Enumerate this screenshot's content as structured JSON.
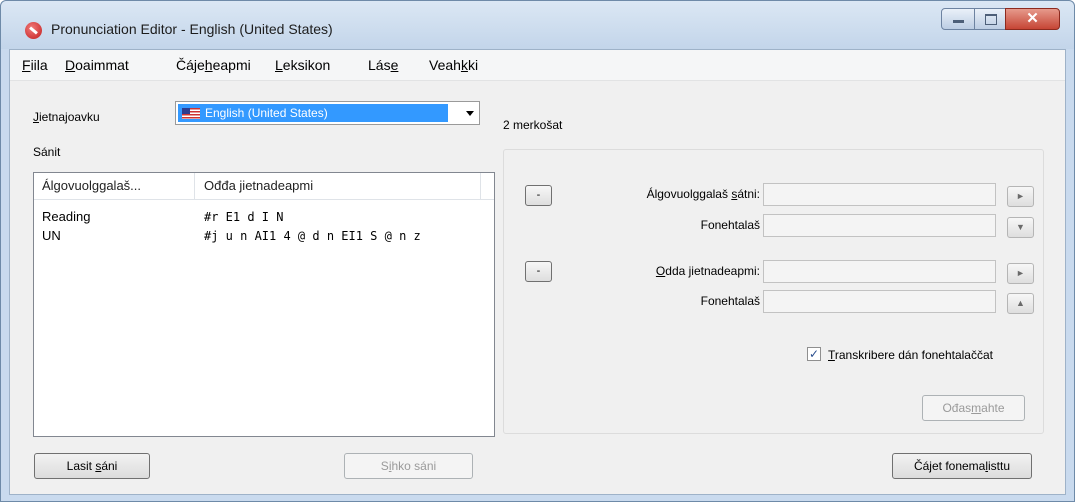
{
  "window": {
    "title": "Pronunciation Editor - English (United States)"
  },
  "menu": [
    {
      "pre": "",
      "ul": "F",
      "post": "iila"
    },
    {
      "pre": "",
      "ul": "D",
      "post": "oaimmat"
    },
    {
      "pre": "Čáje",
      "ul": "h",
      "post": "eapmi"
    },
    {
      "pre": "",
      "ul": "L",
      "post": "eksikon"
    },
    {
      "pre": "Lás",
      "ul": "e",
      "post": ""
    },
    {
      "pre": "Veah",
      "ul": "k",
      "post": "ki"
    }
  ],
  "language": {
    "label_ul": "J",
    "label_rest": "ietnajoavku",
    "selected": "English (United States)"
  },
  "word_count": "2 merkošat",
  "words_label": "Sánit",
  "list": {
    "columns": [
      "Álgovuolggalaš...",
      "Ođđa jietnadeapmi"
    ],
    "rows": [
      {
        "word": "Reading",
        "pron": "#r E1 d I N"
      },
      {
        "word": "UN",
        "pron": "#j u n AI1 4 @ d n EI1 S @ n z"
      }
    ]
  },
  "editor": {
    "minus1": "-",
    "minus2": "-",
    "original_word_label": {
      "pre": "Álgovuolggalaš ",
      "ul": "s",
      "post": "átni:"
    },
    "phonetic_label_1": "Fonehtalaš",
    "new_pron_label": {
      "pre": "",
      "ul": "O",
      "post": "dda jietnadeapmi:"
    },
    "phonetic_label_2": "Fonehtalaš",
    "original_word_value": "",
    "phonetic_value_1": "",
    "new_pron_value": "",
    "phonetic_value_2": "",
    "play1": "►",
    "down": "▼",
    "play2": "►",
    "up": "▲",
    "transcribe": {
      "checked": "✓",
      "pre": "",
      "ul": "T",
      "post": "ranskribere dán fonehtalaččat"
    },
    "clear": {
      "pre": "Ođas",
      "ul": "m",
      "post": "ahte"
    }
  },
  "buttons": {
    "add": {
      "pre": "Lasit ",
      "ul": "s",
      "post": "áni"
    },
    "delete": {
      "pre": "S",
      "ul": "i",
      "post": "hko sáni"
    },
    "phoneme": {
      "pre": "Čájet fonema",
      "ul": "l",
      "post": "isttu"
    }
  }
}
